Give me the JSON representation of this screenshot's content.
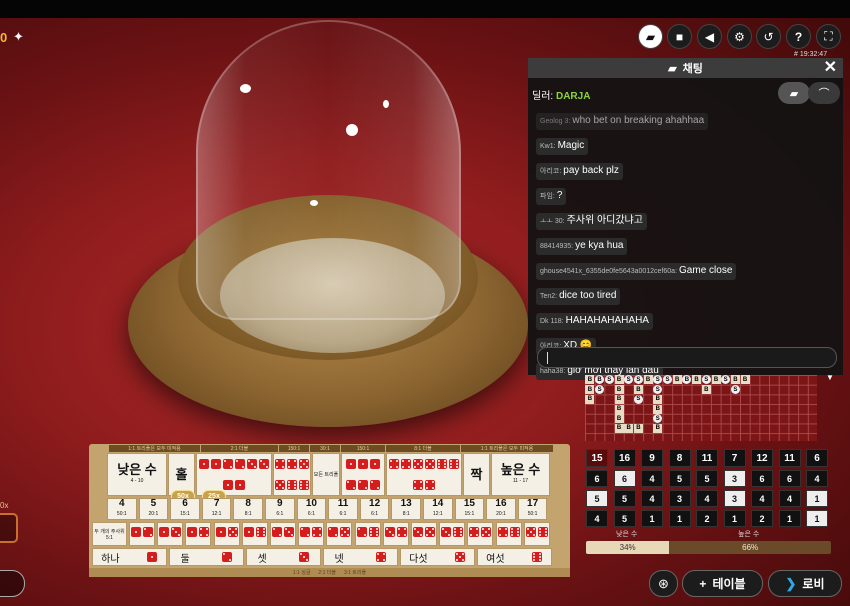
{
  "balance": "0",
  "icons": {
    "pin": "pin-icon",
    "chat": "chat-icon",
    "video": "video-icon",
    "sound": "sound-icon",
    "settings": "gear-icon",
    "history": "history-icon",
    "help": "help-icon",
    "fullscreen": "fullscreen-icon"
  },
  "clock": "# 19:32:47",
  "chat": {
    "title": "채팅",
    "dealer_label": "딜러: ",
    "dealer_name": "DARJA",
    "messages": [
      {
        "user": "Geolog 3:",
        "text": "who bet on breaking ahahhaa"
      },
      {
        "user": "Kw1:",
        "text": "Magic"
      },
      {
        "user": "아리코:",
        "text": "pay back plz"
      },
      {
        "user": "파임:",
        "text": "?"
      },
      {
        "user": "ㅗㅗ 30:",
        "text": "주사위 아디갔냐고"
      },
      {
        "user": "88414935:",
        "text": "ye kya hua"
      },
      {
        "user": "ghouse4541x_6355de0fe5643a0012cef60a:",
        "text": "Game close"
      },
      {
        "user": "Ten2:",
        "text": "dice too tired"
      },
      {
        "user": "Dk 118:",
        "text": "HAHAHAHAHAHA"
      },
      {
        "user": "아리코:",
        "text": "XD 😊"
      },
      {
        "user": "haha38:",
        "text": "giờ mới thấy lần đầu"
      }
    ],
    "input_value": ""
  },
  "stats": {
    "columns": [
      {
        "total": "15",
        "dice": [
          "6",
          "5",
          "4"
        ],
        "white": [
          false,
          true,
          false
        ]
      },
      {
        "total": "16",
        "dice": [
          "6",
          "5",
          "5"
        ],
        "white": [
          true,
          false,
          false
        ]
      },
      {
        "total": "9",
        "dice": [
          "4",
          "4",
          "1"
        ],
        "white": [
          false,
          false,
          false
        ]
      },
      {
        "total": "8",
        "dice": [
          "5",
          "3",
          "1"
        ],
        "white": [
          false,
          false,
          false
        ]
      },
      {
        "total": "11",
        "dice": [
          "5",
          "4",
          "2"
        ],
        "white": [
          false,
          false,
          false
        ]
      },
      {
        "total": "7",
        "dice": [
          "3",
          "3",
          "1"
        ],
        "white": [
          true,
          true,
          false
        ]
      },
      {
        "total": "12",
        "dice": [
          "6",
          "4",
          "2"
        ],
        "white": [
          false,
          false,
          false
        ]
      },
      {
        "total": "11",
        "dice": [
          "6",
          "4",
          "1"
        ],
        "white": [
          false,
          false,
          false
        ]
      },
      {
        "total": "6",
        "dice": [
          "4",
          "1",
          "1"
        ],
        "white": [
          false,
          true,
          true
        ]
      }
    ],
    "low_label": "낮은 수",
    "high_label": "높은 수",
    "low_pct": "34%",
    "high_pct": "66%",
    "low_fraction": 0.34
  },
  "board": {
    "headers": [
      "1:1 트리플은 모두 미적용",
      "2:1 더블",
      "150:1",
      "30:1",
      "150:1",
      "8:1 더블",
      "1:1 트리플은 모두 미적용"
    ],
    "small": {
      "label": "낮은 수",
      "range": "4 - 10"
    },
    "big": {
      "label": "높은 수",
      "range": "11 - 17"
    },
    "odd": "홀",
    "even": "짝",
    "any_triple": "모든 트리플",
    "totals": [
      {
        "n": "4",
        "odds": "50:1"
      },
      {
        "n": "5",
        "odds": "20:1"
      },
      {
        "n": "6",
        "odds": "15:1"
      },
      {
        "n": "7",
        "odds": "12:1"
      },
      {
        "n": "8",
        "odds": "8:1"
      },
      {
        "n": "9",
        "odds": "6:1"
      },
      {
        "n": "10",
        "odds": "6:1"
      },
      {
        "n": "11",
        "odds": "6:1"
      },
      {
        "n": "12",
        "odds": "6:1"
      },
      {
        "n": "13",
        "odds": "8:1"
      },
      {
        "n": "14",
        "odds": "12:1"
      },
      {
        "n": "15",
        "odds": "15:1"
      },
      {
        "n": "16",
        "odds": "20:1"
      },
      {
        "n": "17",
        "odds": "50:1"
      }
    ],
    "chips": [
      "50x",
      "25x"
    ],
    "combo_label": "두 개의 주사위 5:1",
    "singles": [
      "하나",
      "둘",
      "셋",
      "넷",
      "다섯",
      "여섯"
    ],
    "footer": [
      "1:1 싱글",
      "2:1 더블",
      "3:1 트리플"
    ]
  },
  "left_multiplier": "0x",
  "bottom": {
    "tables": "테이블",
    "lobby": "로비"
  }
}
